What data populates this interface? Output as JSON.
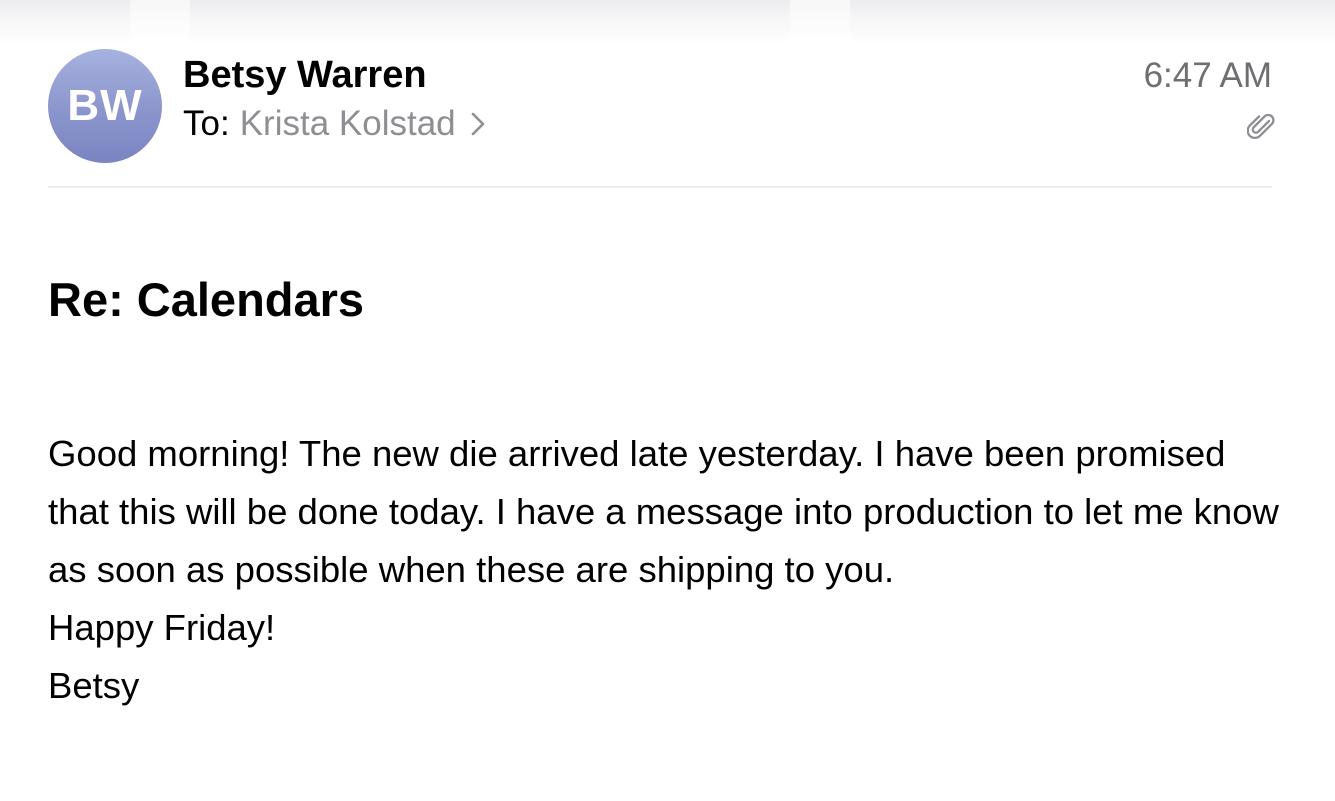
{
  "header": {
    "avatar_initials": "BW",
    "sender_name": "Betsy Warren",
    "to_label": "To:",
    "recipient_name": "Krista Kolstad",
    "time": "6:47 AM",
    "attachment_icon": "paperclip-icon",
    "chevron_icon": "chevron-right-icon"
  },
  "message": {
    "subject": "Re: Calendars",
    "body_paragraph": "Good morning! The new die arrived late yesterday. I have been promised that this will be done today. I have a message into production to let me know as soon as possible when these are shipping to you.",
    "closing": "Happy Friday!",
    "signature": "Betsy"
  },
  "colors": {
    "avatar_gradient_top": "#a6b2df",
    "avatar_gradient_bottom": "#7a84c2",
    "secondary_text": "#8e8e93",
    "time_text": "#6e6e73",
    "divider": "#ededee"
  }
}
